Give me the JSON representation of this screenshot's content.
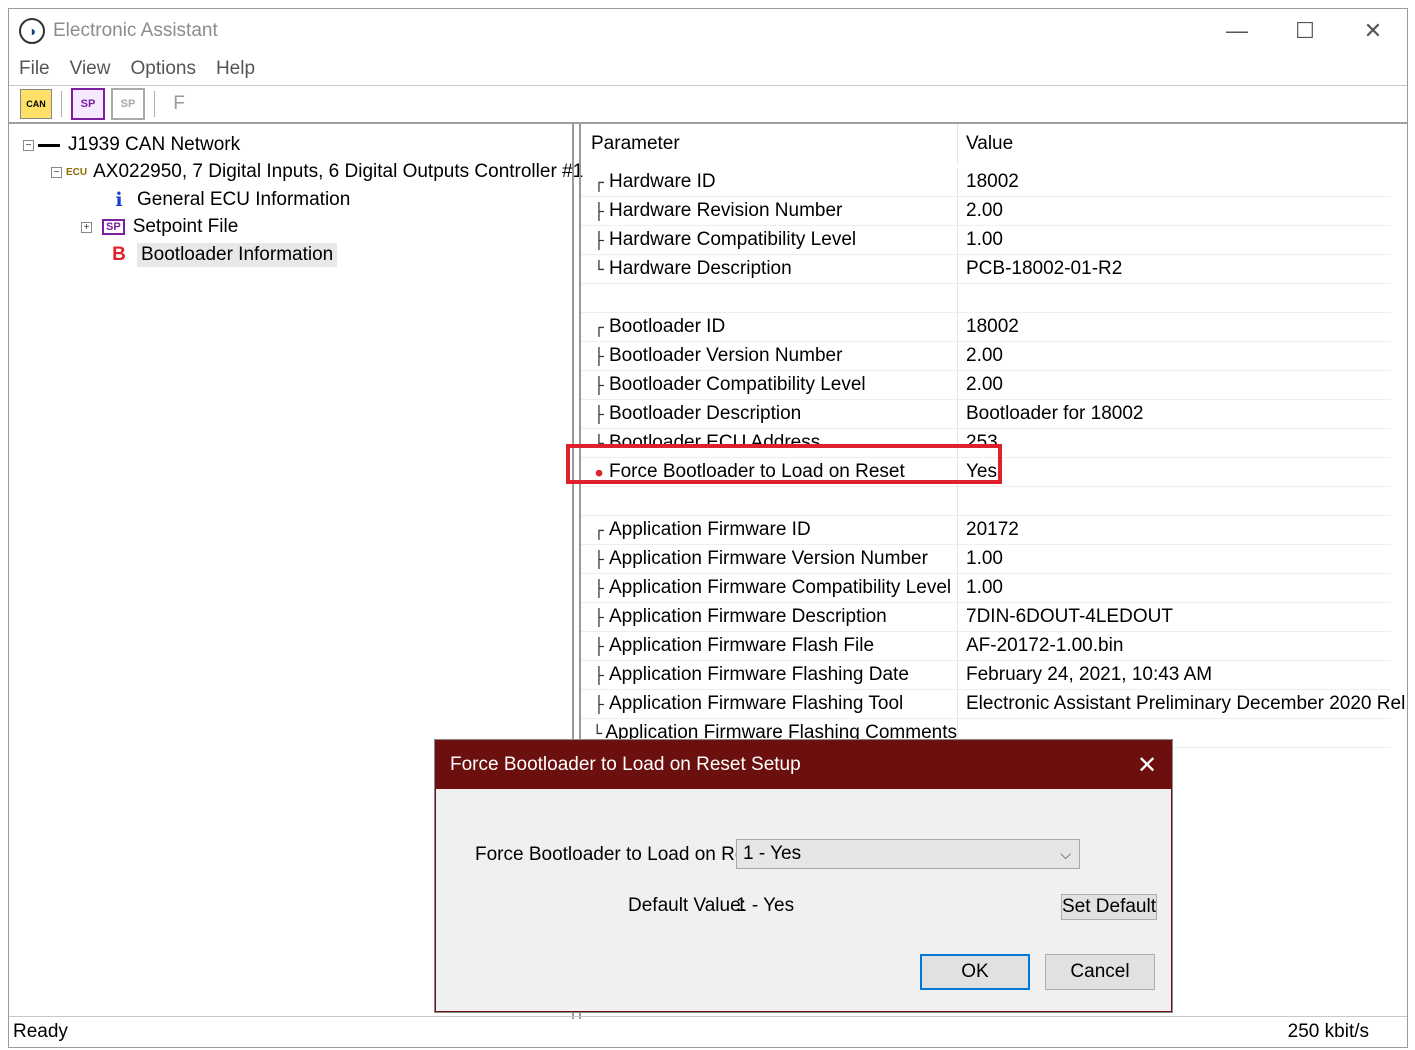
{
  "window": {
    "title": "Electronic Assistant",
    "controls": {
      "minimize": "—",
      "maximize": "☐",
      "close": "✕"
    }
  },
  "menu": [
    "File",
    "View",
    "Options",
    "Help"
  ],
  "toolbar": {
    "can_icon": "CAN",
    "sp_icon": "SP",
    "sp_disabled_icon": "SP",
    "f_label": "F"
  },
  "tree": {
    "network": "J1939 CAN Network",
    "ecu_tag": "ECU",
    "controller": "AX022950, 7 Digital Inputs, 6 Digital Outputs Controller #1",
    "items": [
      {
        "icon": "i",
        "label": "General ECU Information"
      },
      {
        "icon": "SP",
        "label": "Setpoint File"
      },
      {
        "icon": "B",
        "label": "Bootloader Information"
      }
    ]
  },
  "grid": {
    "header": {
      "param": "Parameter",
      "value": "Value"
    },
    "rows": [
      {
        "connector": "┌",
        "param": "Hardware ID",
        "value": "18002"
      },
      {
        "connector": "├",
        "param": "Hardware Revision Number",
        "value": "2.00"
      },
      {
        "connector": "├",
        "param": "Hardware Compatibility Level",
        "value": "1.00"
      },
      {
        "connector": "└",
        "param": "Hardware Description",
        "value": "PCB-18002-01-R2"
      },
      {
        "connector": "",
        "param": "",
        "value": ""
      },
      {
        "connector": "┌",
        "param": "Bootloader ID",
        "value": "18002"
      },
      {
        "connector": "├",
        "param": "Bootloader Version Number",
        "value": "2.00"
      },
      {
        "connector": "├",
        "param": "Bootloader Compatibility Level",
        "value": "2.00"
      },
      {
        "connector": "├",
        "param": "Bootloader Description",
        "value": "Bootloader for 18002"
      },
      {
        "connector": "└",
        "param": "Bootloader ECU Address",
        "value": "253"
      },
      {
        "connector": "●",
        "param": "Force Bootloader to Load on Reset",
        "value": "Yes"
      },
      {
        "connector": "",
        "param": "",
        "value": ""
      },
      {
        "connector": "┌",
        "param": "Application Firmware ID",
        "value": "20172"
      },
      {
        "connector": "├",
        "param": "Application Firmware Version Number",
        "value": "1.00"
      },
      {
        "connector": "├",
        "param": "Application Firmware Compatibility Level",
        "value": "1.00"
      },
      {
        "connector": "├",
        "param": "Application Firmware Description",
        "value": "7DIN-6DOUT-4LEDOUT"
      },
      {
        "connector": "├",
        "param": "Application Firmware Flash File",
        "value": "AF-20172-1.00.bin"
      },
      {
        "connector": "├",
        "param": "Application Firmware Flashing Date",
        "value": "February 24, 2021, 10:43 AM"
      },
      {
        "connector": "├",
        "param": "Application Firmware Flashing Tool",
        "value": "Electronic Assistant Preliminary December 2020 Rel"
      },
      {
        "connector": "└",
        "param": "Application Firmware Flashing Comments",
        "value": ""
      }
    ]
  },
  "dialog": {
    "title": "Force Bootloader to Load on Reset Setup",
    "field_label": "Force Bootloader to Load on Reset:",
    "selected": "1 - Yes",
    "default_label": "Default Value:",
    "default_value": "1 - Yes",
    "set_default": "Set Default",
    "ok": "OK",
    "cancel": "Cancel"
  },
  "status": {
    "left": "Ready",
    "right": "250 kbit/s"
  },
  "colors": {
    "dialog_title_bg": "#6b0f0f",
    "highlight": "#e0202a",
    "connector_marker": "#e0202a",
    "sp_icon": "#7b1fa2",
    "bootloader_icon": "#e0202a",
    "info_icon": "#1a3fcf"
  }
}
